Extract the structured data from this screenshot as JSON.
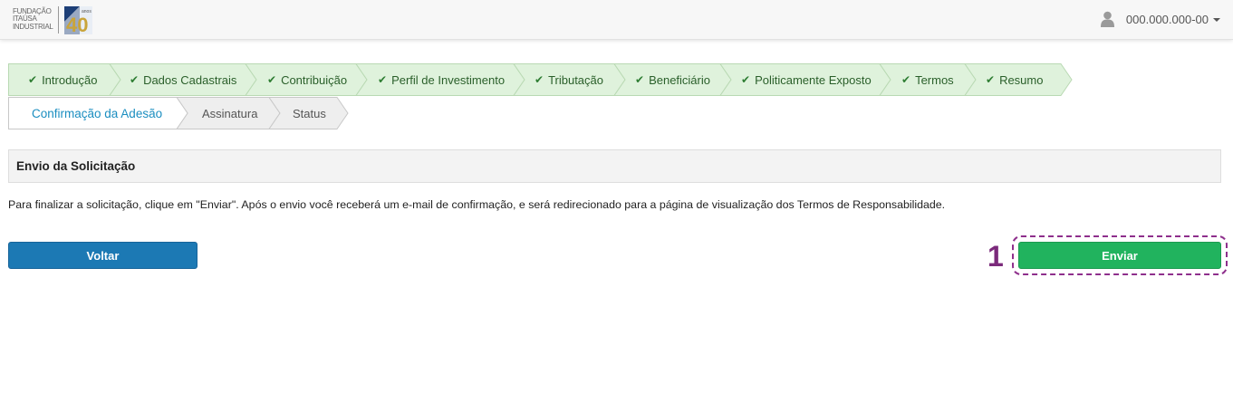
{
  "header": {
    "logo_text": [
      "Fundação",
      "Itaúsa",
      "Industrial"
    ],
    "logo_badge": "40",
    "logo_badge_small": "anos",
    "user_id": "000.000.000-00"
  },
  "wizard": {
    "row1": [
      {
        "label": "Introdução",
        "state": "done"
      },
      {
        "label": "Dados Cadastrais",
        "state": "done"
      },
      {
        "label": "Contribuição",
        "state": "done"
      },
      {
        "label": "Perfil de Investimento",
        "state": "done"
      },
      {
        "label": "Tributação",
        "state": "done"
      },
      {
        "label": "Beneficiário",
        "state": "done"
      },
      {
        "label": "Politicamente Exposto",
        "state": "done"
      },
      {
        "label": "Termos",
        "state": "done"
      },
      {
        "label": "Resumo",
        "state": "done"
      }
    ],
    "row2": [
      {
        "label": "Confirmação da Adesão",
        "state": "active"
      },
      {
        "label": "Assinatura",
        "state": "pending"
      },
      {
        "label": "Status",
        "state": "pending"
      }
    ],
    "check_icon": "check-icon"
  },
  "panel": {
    "title": "Envio da Solicitação",
    "text": "Para finalizar a solicitação, clique em \"Enviar\". Após o envio você receberá um e-mail de confirmação, e será redirecionado para a página de visualização dos Termos de Responsabilidade."
  },
  "actions": {
    "back_label": "Voltar",
    "send_label": "Enviar",
    "annotation_number": "1"
  },
  "colors": {
    "done_fill": "#dff2dc",
    "done_border": "#b9d9b3",
    "active_fill": "#ffffff",
    "pending_fill": "#eeeeee",
    "back_button": "#1c79b4",
    "send_button": "#21b35e",
    "annotation": "#8e2f8c"
  }
}
